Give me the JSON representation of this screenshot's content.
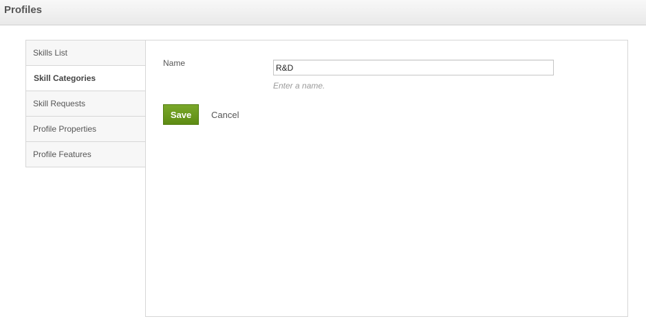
{
  "header": {
    "title": "Profiles"
  },
  "sidebar": {
    "items": [
      {
        "label": "Skills List",
        "active": false
      },
      {
        "label": "Skill Categories",
        "active": true
      },
      {
        "label": "Skill Requests",
        "active": false
      },
      {
        "label": "Profile Properties",
        "active": false
      },
      {
        "label": "Profile Features",
        "active": false
      }
    ]
  },
  "form": {
    "name_label": "Name",
    "name_value": "R&D",
    "name_help": "Enter a name.",
    "save_label": "Save",
    "cancel_label": "Cancel"
  },
  "colors": {
    "save_button": "#6a9a1f",
    "header_bg": "#eeeeee",
    "border": "#d6d6d6"
  }
}
